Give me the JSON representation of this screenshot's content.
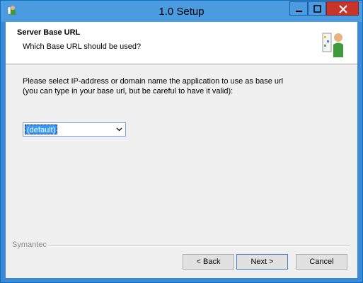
{
  "window": {
    "title": "1.0 Setup",
    "icon": "installer-person-icon"
  },
  "header": {
    "title": "Server Base URL",
    "subtitle": "Which Base URL should be used?",
    "icon": "installer-person-icon"
  },
  "body": {
    "line1": "Please select IP-address or domain name the application to use as base url",
    "line2": "(you can type in your base url, but be careful to have it valid):",
    "select": {
      "value": "(default)"
    }
  },
  "footer": {
    "brand": "Symantec",
    "back_label": "< Back",
    "next_label": "Next >",
    "cancel_label": "Cancel"
  },
  "colors": {
    "titlebar": "#4a9be0",
    "close_button": "#c7352a",
    "selection": "#3399ff"
  }
}
